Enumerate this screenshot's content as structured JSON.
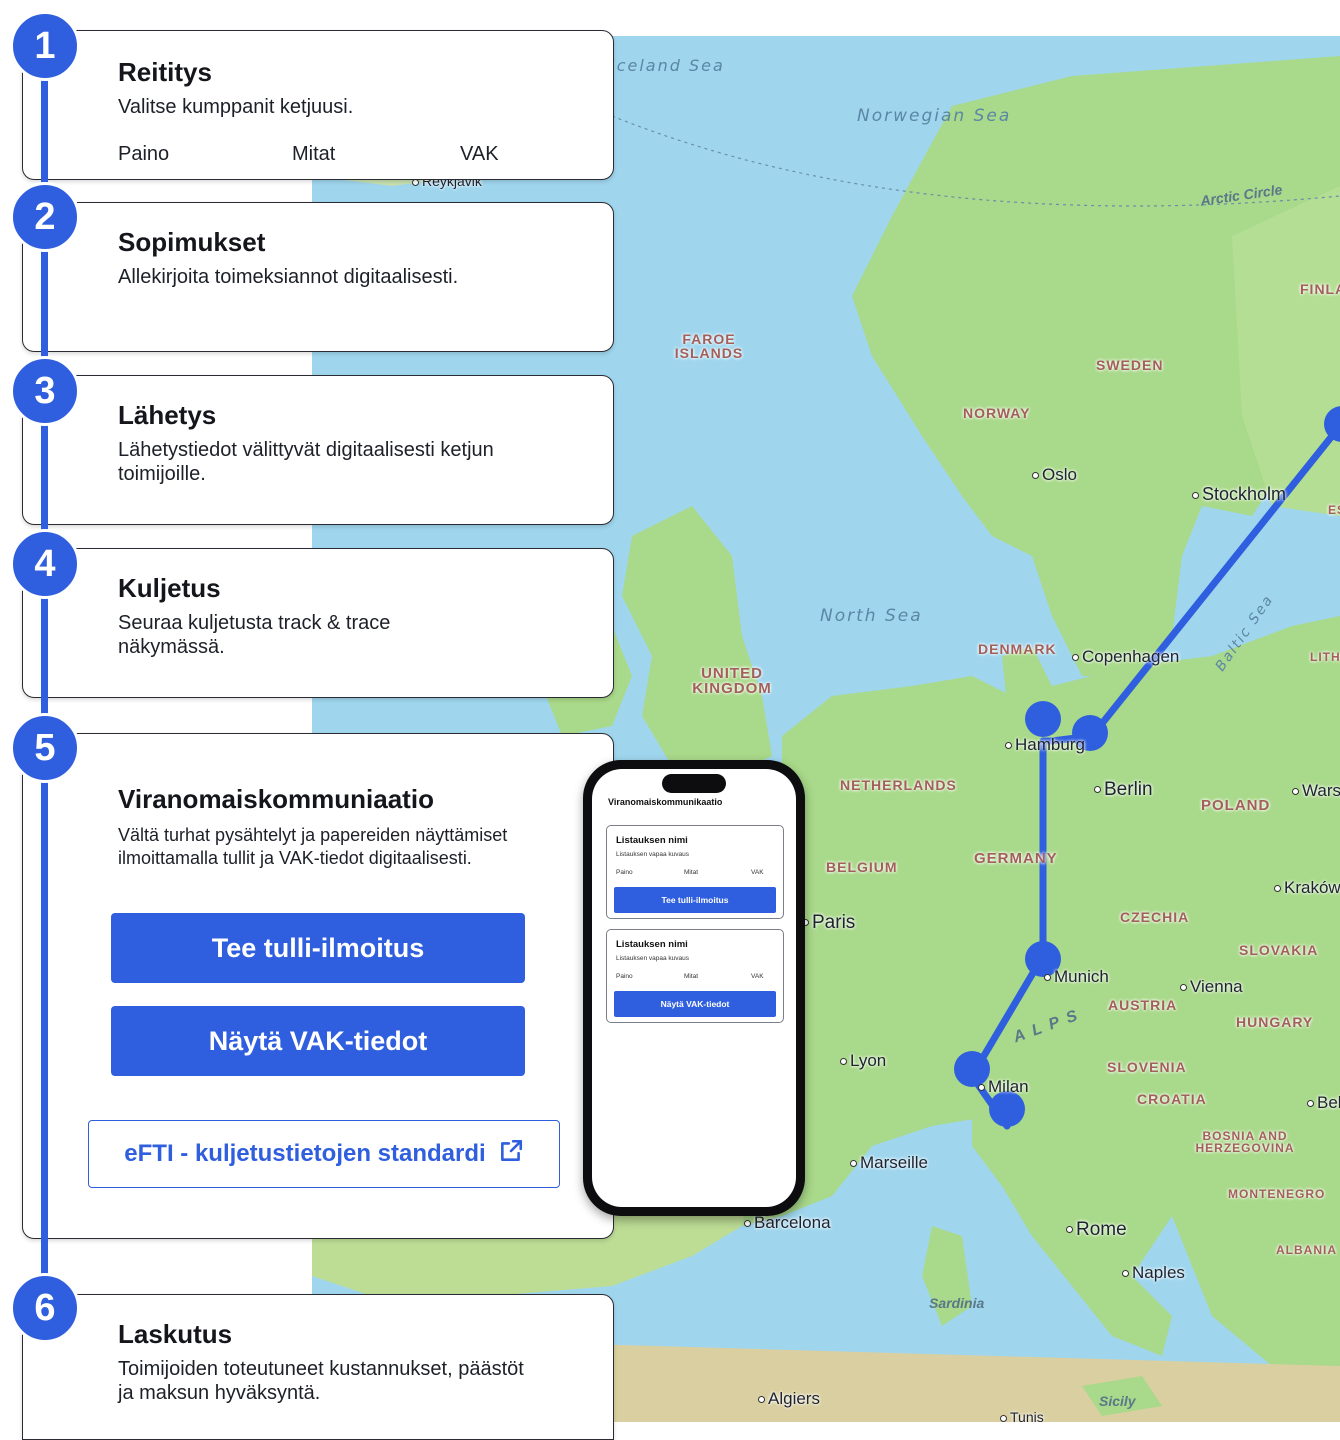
{
  "steps": [
    {
      "number": "1",
      "title": "Reititys",
      "description": "Valitse kumppanit ketjuusi.",
      "chips": [
        "Paino",
        "Mitat",
        "VAK"
      ]
    },
    {
      "number": "2",
      "title": "Sopimukset",
      "description": "Allekirjoita toimeksiannot digitaalisesti."
    },
    {
      "number": "3",
      "title": "Lähetys",
      "description": "Lähetystiedot välittyvät digitaalisesti ketjun toimijoille."
    },
    {
      "number": "4",
      "title": "Kuljetus",
      "description": "Seuraa kuljetusta track & trace näkymässä."
    },
    {
      "number": "5",
      "title": "Viranomaiskommuniaatio",
      "description": "Vältä turhat pysähtelyt ja papereiden näyttämiset ilmoittamalla tullit ja VAK-tiedot digitaalisesti.",
      "primary_button": "Tee tulli-ilmoitus",
      "secondary_button": "Näytä VAK-tiedot",
      "link_button": "eFTI - kuljetustietojen standardi"
    },
    {
      "number": "6",
      "title": "Laskutus",
      "description": "Toimijoiden toteutuneet kustannukset, päästöt ja maksun hyväksyntä."
    }
  ],
  "phone": {
    "title": "Viranomaiskommunikaatio",
    "cards": [
      {
        "name": "Listauksen nimi",
        "description": "Listauksen vapaa kuvaus",
        "chips": [
          "Paino",
          "Mitat",
          "VAK"
        ],
        "button": "Tee tulli-ilmoitus"
      },
      {
        "name": "Listauksen nimi",
        "description": "Listauksen vapaa kuvaus",
        "chips": [
          "Paino",
          "Mitat",
          "VAK"
        ],
        "button": "Näytä VAK-tiedot"
      }
    ]
  },
  "map": {
    "cities": [
      "Reykjavik",
      "Oslo",
      "Stockholm",
      "Copenhagen",
      "Hamburg",
      "Berlin",
      "Warsaw",
      "Kraków",
      "Munich",
      "Vienna",
      "Lyon",
      "Milan",
      "Marseille",
      "Barcelona",
      "Rome",
      "Naples",
      "Algiers",
      "Paris",
      "Belgrade",
      "Tunis"
    ],
    "countries": [
      "FAROE ISLANDS",
      "NORWAY",
      "SWEDEN",
      "FINLAND",
      "DENMARK",
      "UNITED KINGDOM",
      "NETHERLANDS",
      "BELGIUM",
      "GERMANY",
      "POLAND",
      "CZECHIA",
      "SLOVAKIA",
      "AUSTRIA",
      "HUNGARY",
      "SLOVENIA",
      "CROATIA",
      "BOSNIA AND HERZEGOVINA",
      "MONTENEGRO",
      "ALBANIA",
      "LITHUANIA",
      "ESTONIA"
    ],
    "seas": [
      "Iceland Sea",
      "Norwegian Sea",
      "North Sea",
      "Baltic Sea"
    ],
    "other_labels": [
      "Arctic Circle",
      "ALPS",
      "Sardinia",
      "Sicily"
    ],
    "route_color": "#2f5fde"
  },
  "colors": {
    "accent": "#2f5fde",
    "land": "#a9d98a",
    "water": "#9fd6ee"
  }
}
